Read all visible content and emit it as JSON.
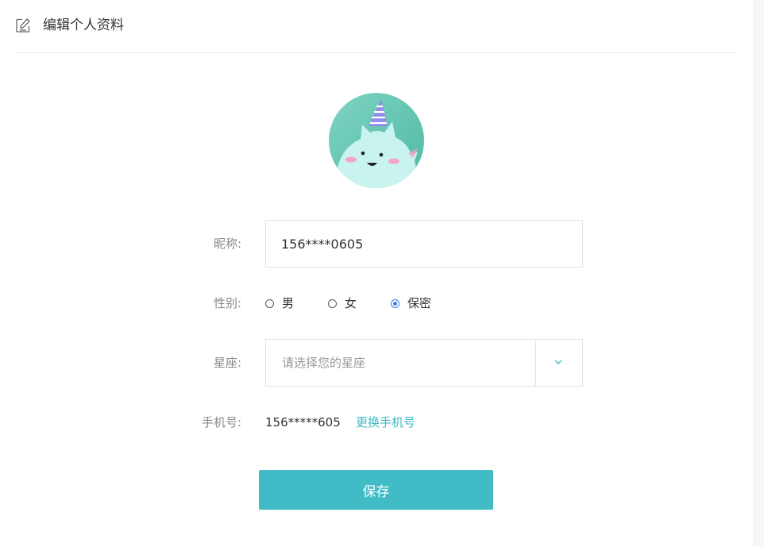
{
  "header": {
    "title": "编辑个人资料",
    "icon": "edit-icon"
  },
  "avatar": {
    "icon": "cat-party-hat-avatar"
  },
  "form": {
    "nickname": {
      "label": "昵称:",
      "value": "156****0605"
    },
    "gender": {
      "label": "性别:",
      "options": [
        {
          "label": "男",
          "checked": false
        },
        {
          "label": "女",
          "checked": false
        },
        {
          "label": "保密",
          "checked": true
        }
      ]
    },
    "constellation": {
      "label": "星座:",
      "placeholder": "请选择您的星座",
      "icon": "chevron-down-icon"
    },
    "phone": {
      "label": "手机号:",
      "value": "156*****605",
      "change_link": "更换手机号"
    }
  },
  "save_label": "保存",
  "colors": {
    "accent": "#41bcc7",
    "link": "#3cb8c6",
    "radio_checked": "#3a7ce6"
  }
}
